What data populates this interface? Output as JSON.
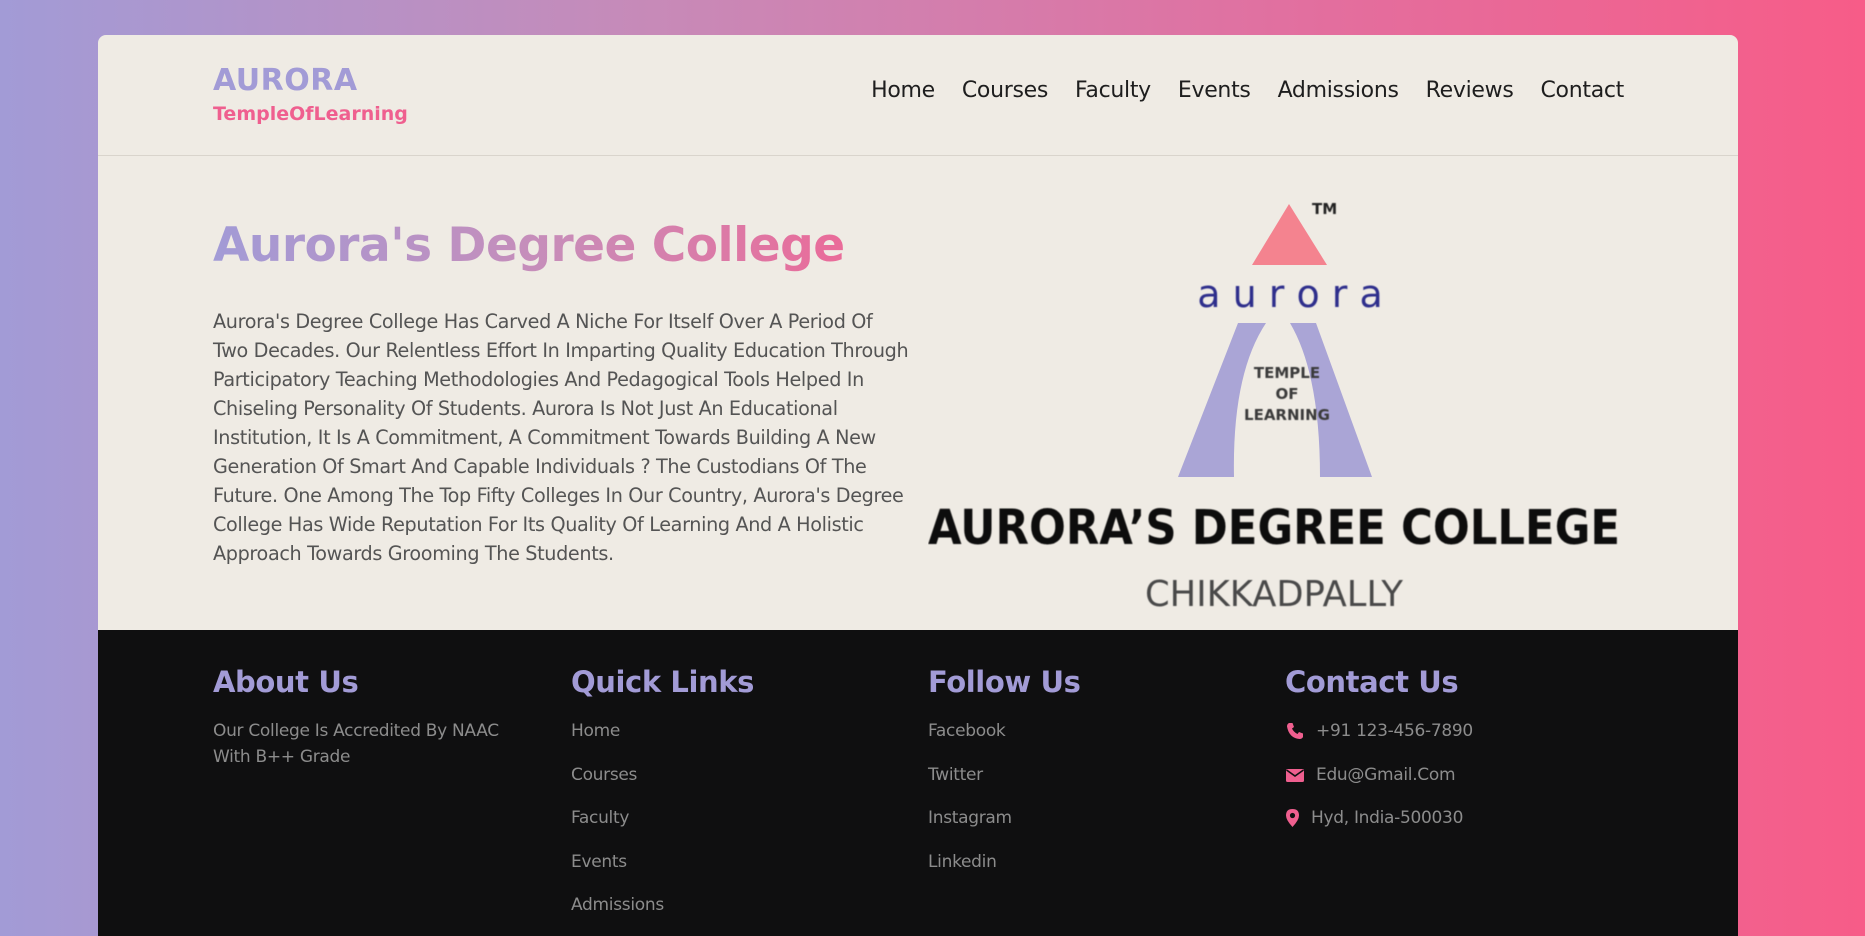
{
  "brand": {
    "name": "AURORA",
    "tagline": "TempleOfLearning"
  },
  "nav": [
    "Home",
    "Courses",
    "Faculty",
    "Events",
    "Admissions",
    "Reviews",
    "Contact"
  ],
  "hero": {
    "title": "Aurora's Degree College",
    "description": "Aurora's Degree College Has Carved A Niche For Itself Over A Period Of Two Decades. Our Relentless Effort In Imparting Quality Education Through Participatory Teaching Methodologies And Pedagogical Tools Helped In Chiseling Personality Of Students. Aurora Is Not Just An Educational Institution, It Is A Commitment, A Commitment Towards Building A New Generation Of Smart And Capable Individuals ? The Custodians Of The Future. One Among The Top Fifty Colleges In Our Country, Aurora's Degree College Has Wide Reputation For Its Quality Of Learning And A Holistic Approach Towards Grooming The Students."
  },
  "logo": {
    "tm": "TM",
    "word": "a u r o r a",
    "inner_line1": "TEMPLE",
    "inner_line2": "OF",
    "inner_line3": "LEARNING",
    "college": "AURORA’S DEGREE COLLEGE",
    "location": "CHIKKADPALLY"
  },
  "footer": {
    "about": {
      "heading": "About Us",
      "text": "Our College Is Accredited By NAAC With B++ Grade"
    },
    "quick_links": {
      "heading": "Quick Links",
      "items": [
        "Home",
        "Courses",
        "Faculty",
        "Events",
        "Admissions"
      ]
    },
    "follow": {
      "heading": "Follow Us",
      "items": [
        "Facebook",
        "Twitter",
        "Instagram",
        "Linkedin"
      ]
    },
    "contact": {
      "heading": "Contact Us",
      "items": [
        {
          "icon": "phone-icon",
          "text": "+91 123-456-7890"
        },
        {
          "icon": "envelope-icon",
          "text": "Edu@Gmail.Com"
        },
        {
          "icon": "map-pin-icon",
          "text": "Hyd, India-500030"
        }
      ]
    }
  },
  "colors": {
    "primary": "#a29bd6",
    "accent": "#ef5f8f",
    "background": "#efebe4",
    "footer": "#0f0f10",
    "logo_triangle": "#f4838f",
    "logo_arch": "#aaa5d6"
  }
}
